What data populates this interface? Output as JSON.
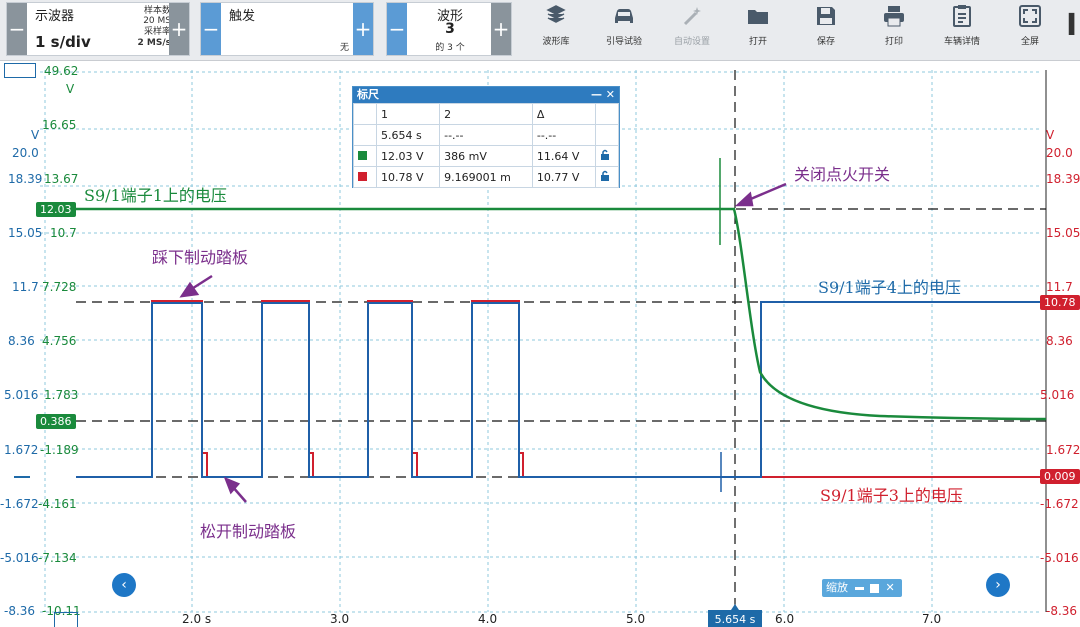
{
  "toolbar": {
    "scope_ctrl": {
      "title": "示波器",
      "value": "1 s/div",
      "samples_label": "样本数",
      "samples_value": "20 MS",
      "rate_label": "采样率",
      "rate_value": "2 MS/s"
    },
    "trigger_ctrl": {
      "title": "触发",
      "value": "无"
    },
    "wave_ctrl": {
      "title": "波形",
      "value": "3",
      "sub": "的 3 个"
    },
    "minus": "−",
    "plus": "+",
    "buttons": [
      {
        "label": "波形库",
        "icon": "library-icon"
      },
      {
        "label": "引导试验",
        "icon": "car-icon"
      },
      {
        "label": "自动设置",
        "icon": "wand-icon"
      },
      {
        "label": "打开",
        "icon": "folder-icon"
      },
      {
        "label": "保存",
        "icon": "save-icon"
      },
      {
        "label": "打印",
        "icon": "print-icon"
      },
      {
        "label": "车辆详情",
        "icon": "clipboard-icon"
      },
      {
        "label": "全屏",
        "icon": "fullscreen-icon"
      }
    ],
    "right_edge": "I"
  },
  "colors": {
    "green": "#1a8a3c",
    "blue": "#1f5fa8",
    "red": "#d0202e",
    "magenta": "#7b2f8c"
  },
  "axes": {
    "left_col1_unit": "V",
    "left_col1": [
      "49.62",
      "16.65",
      "13.67",
      "10.7",
      "7.728",
      "4.756",
      "1.783",
      "-1.189",
      "-4.161",
      "-7.134",
      "-10.11"
    ],
    "left_col1_unit_top": "V",
    "left_col2": [
      "20.0",
      "18.39",
      "15.05",
      "11.7",
      "8.36",
      "5.016",
      "1.672",
      "-1.672",
      "-5.016",
      "-8.36"
    ],
    "right_unit": "V",
    "right": [
      "20.0",
      "18.39",
      "15.05",
      "11.7",
      "8.36",
      "5.016",
      "1.672",
      "-1.672",
      "-5.016",
      "-8.36"
    ],
    "x_ticks": [
      "2.0 s",
      "3.0",
      "4.0",
      "5.0",
      "6.0",
      "7.0"
    ]
  },
  "markers": {
    "green_level": "12.03",
    "cursor_level": "0.386",
    "red_level": "10.78",
    "red_zero": "0.009",
    "cursor_x": "5.654 s"
  },
  "ruler": {
    "title": "标尺",
    "controls": "— ✕",
    "headers": [
      "1",
      "2",
      "Δ"
    ],
    "time_row": [
      "5.654 s",
      "--.--",
      "--.--"
    ],
    "rows": [
      {
        "color": "#1a8a3c",
        "v1": "12.03 V",
        "v2": "386 mV",
        "delta": "11.64 V"
      },
      {
        "color": "#d0202e",
        "v1": "10.78 V",
        "v2": "9.169001 m",
        "delta": "10.77 V"
      }
    ]
  },
  "annotations": {
    "green_trace": "S9/1端子1上的电压",
    "ignition_off": "关闭点火开关",
    "press_brake": "踩下制动踏板",
    "blue_trace": "S9/1端子4上的电压",
    "release_brake": "松开制动踏板",
    "red_trace": "S9/1端子3上的电压"
  },
  "zoom": {
    "label": "缩放"
  },
  "nav": {
    "left": "‹",
    "right": "›"
  }
}
